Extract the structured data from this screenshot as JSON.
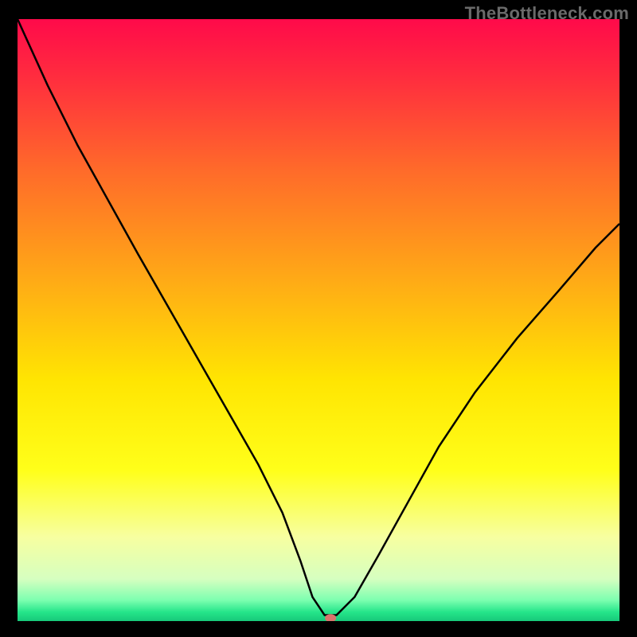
{
  "watermark": "TheBottleneck.com",
  "chart_data": {
    "type": "line",
    "title": "",
    "xlabel": "",
    "ylabel": "",
    "xlim": [
      0,
      100
    ],
    "ylim": [
      0,
      100
    ],
    "grid": false,
    "legend": false,
    "background_gradient": {
      "stops": [
        {
          "offset": 0.0,
          "color": "#ff0a4a"
        },
        {
          "offset": 0.1,
          "color": "#ff2e3e"
        },
        {
          "offset": 0.25,
          "color": "#ff6a2a"
        },
        {
          "offset": 0.45,
          "color": "#ffb014"
        },
        {
          "offset": 0.6,
          "color": "#ffe502"
        },
        {
          "offset": 0.75,
          "color": "#ffff1a"
        },
        {
          "offset": 0.86,
          "color": "#f7ffa0"
        },
        {
          "offset": 0.93,
          "color": "#d6ffc0"
        },
        {
          "offset": 0.965,
          "color": "#7dffb0"
        },
        {
          "offset": 0.985,
          "color": "#25e58a"
        },
        {
          "offset": 1.0,
          "color": "#17c97a"
        }
      ]
    },
    "series": [
      {
        "name": "bottleneck-curve",
        "color": "#000000",
        "stroke_width": 2.5,
        "x": [
          0,
          5,
          10,
          15,
          20,
          24,
          28,
          32,
          36,
          40,
          44,
          47,
          49,
          51,
          53,
          56,
          60,
          65,
          70,
          76,
          83,
          90,
          96,
          100
        ],
        "y": [
          100,
          89,
          79,
          70,
          61,
          54,
          47,
          40,
          33,
          26,
          18,
          10,
          4,
          1,
          1,
          4,
          11,
          20,
          29,
          38,
          47,
          55,
          62,
          66
        ]
      }
    ],
    "marker": {
      "name": "min-point-marker",
      "x": 52,
      "y": 0.5,
      "rx": 7,
      "ry": 5,
      "color": "#d9746c"
    }
  }
}
